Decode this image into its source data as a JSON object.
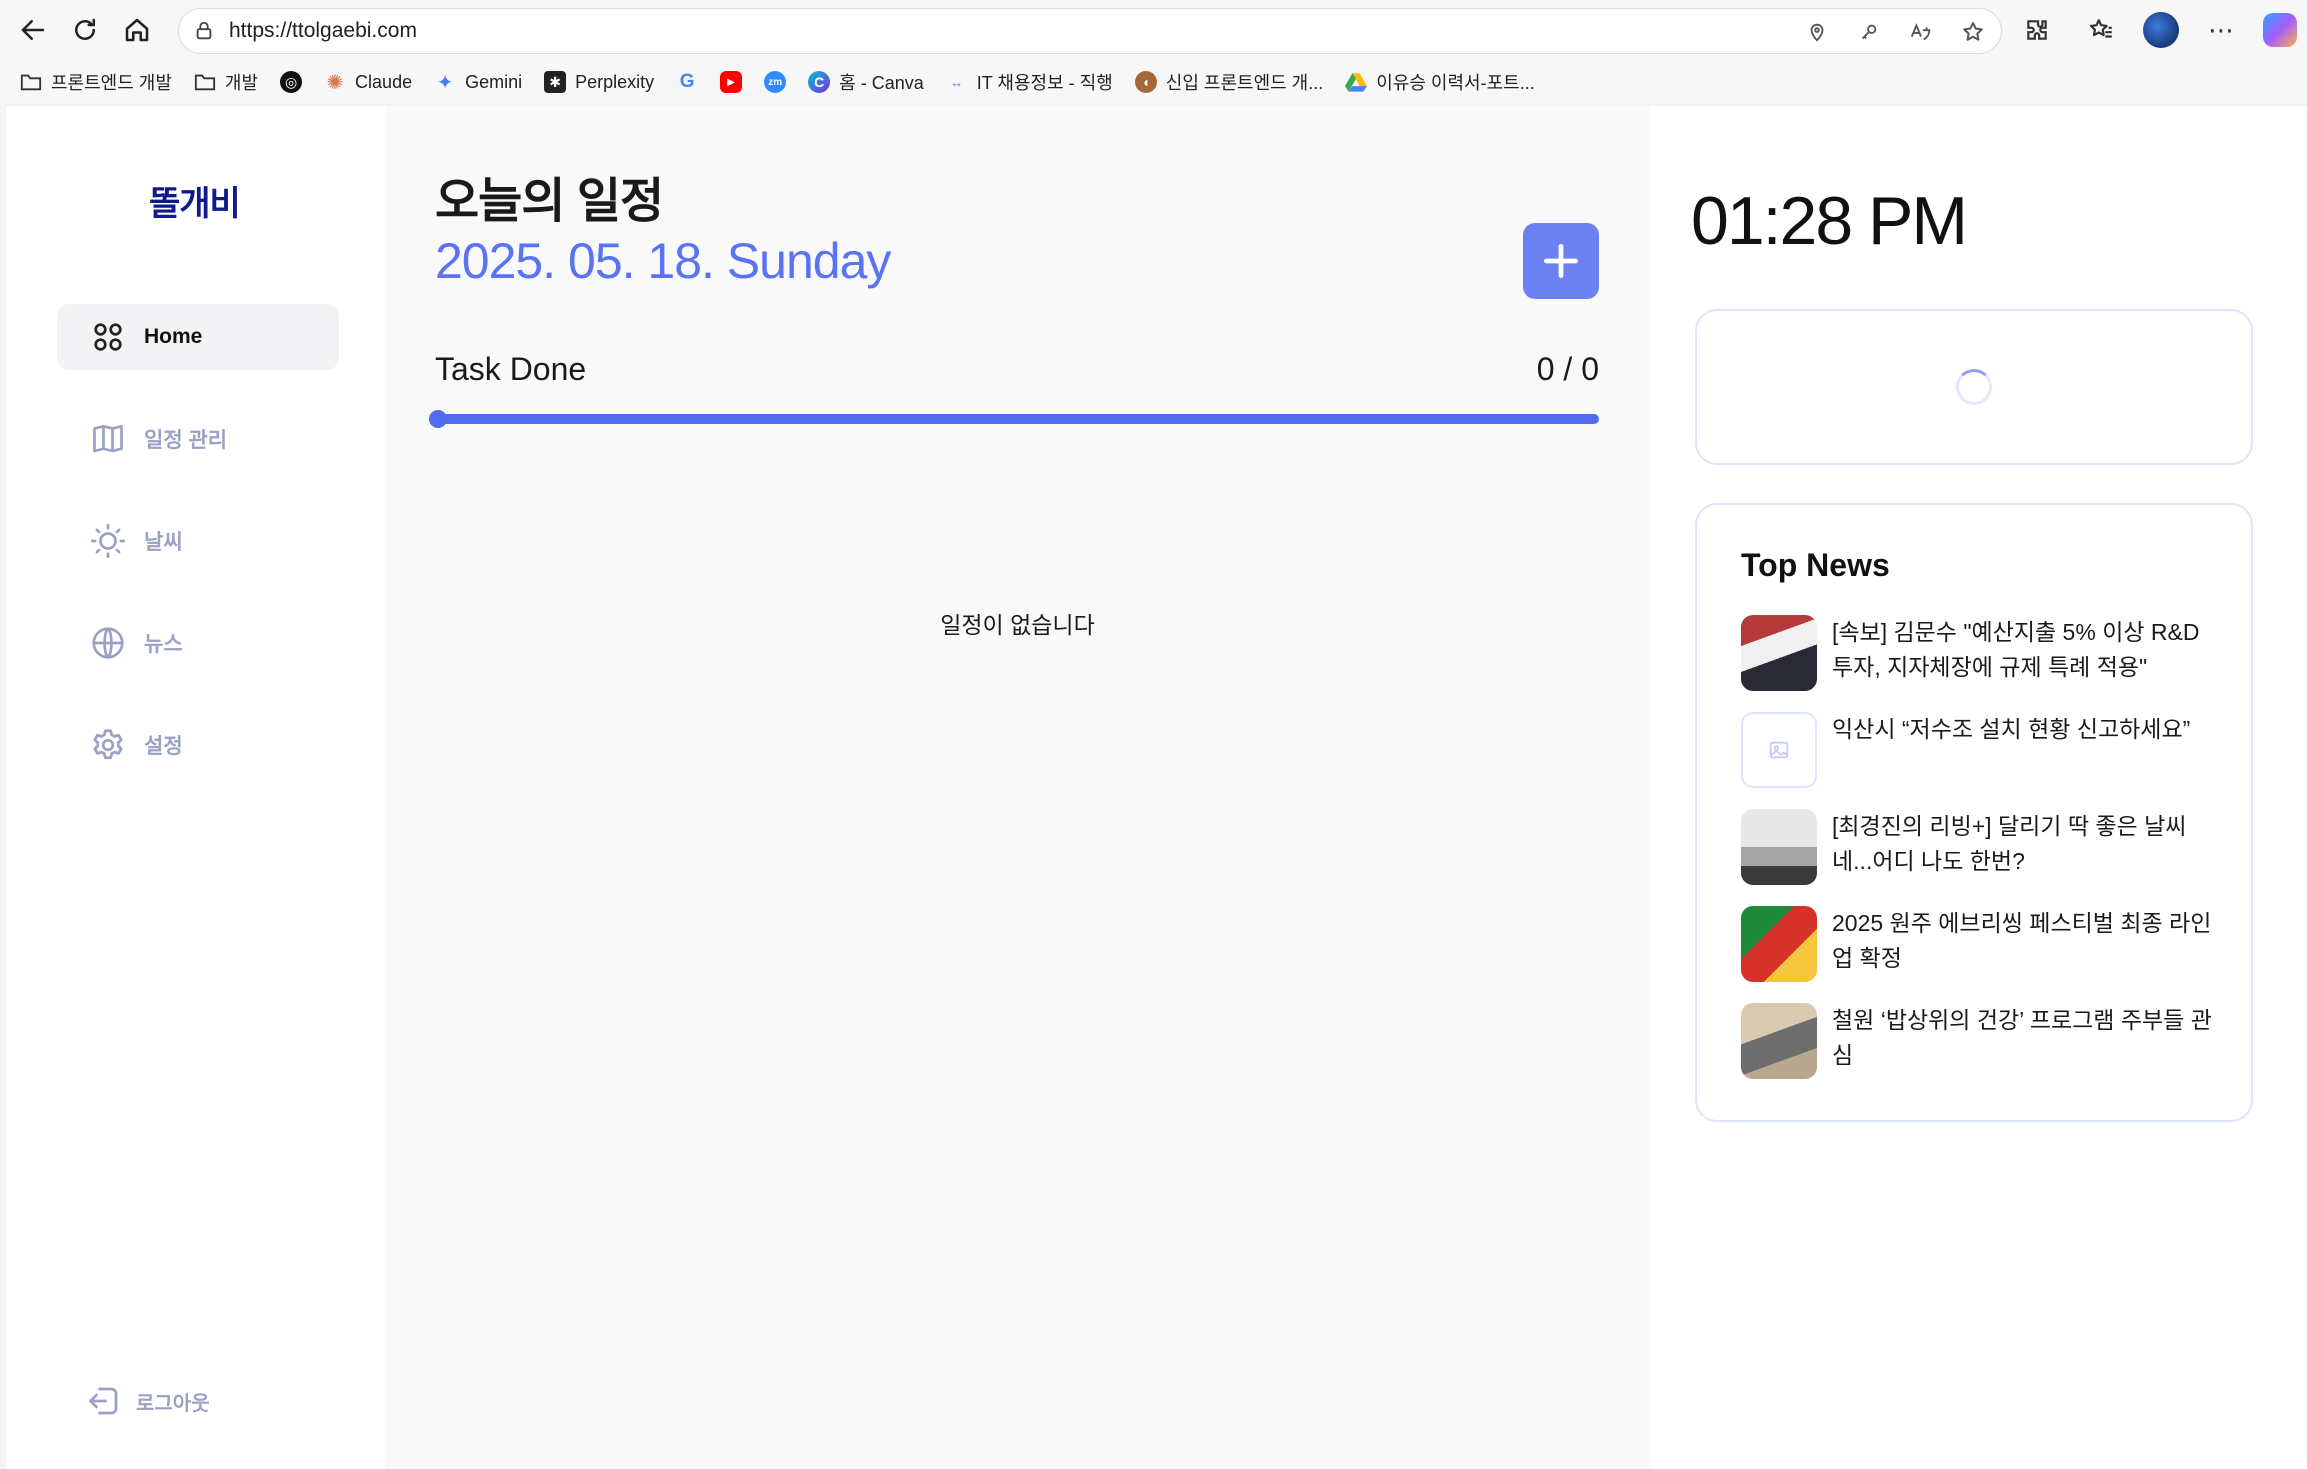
{
  "browser": {
    "url": "https://ttolgaebi.com",
    "icons": {
      "back": "arrow-left-icon",
      "refresh": "refresh-icon",
      "home": "home-icon"
    },
    "bookmarks": [
      {
        "label": "프론트엔드 개발",
        "icon": "folder-icon"
      },
      {
        "label": "개발",
        "icon": "folder-icon"
      },
      {
        "label": "",
        "icon": "openai-icon"
      },
      {
        "label": "Claude",
        "icon": "claude-icon"
      },
      {
        "label": "Gemini",
        "icon": "gemini-icon"
      },
      {
        "label": "Perplexity",
        "icon": "perplexity-icon"
      },
      {
        "label": "",
        "icon": "google-icon"
      },
      {
        "label": "",
        "icon": "youtube-icon"
      },
      {
        "label": "",
        "icon": "zoom-icon"
      },
      {
        "label": "홈 - Canva",
        "icon": "canva-icon"
      },
      {
        "label": "IT 채용정보 - 직행",
        "icon": "jikhaeng-icon"
      },
      {
        "label": "신입 프론트엔드 개...",
        "icon": "squirrel-icon"
      },
      {
        "label": "이유승 이력서-포트...",
        "icon": "google-drive-icon"
      }
    ]
  },
  "sidebar": {
    "logo": "똘개비",
    "items": [
      {
        "label": "Home",
        "icon": "grid-icon",
        "active": true
      },
      {
        "label": "일정 관리",
        "icon": "book-icon",
        "active": false
      },
      {
        "label": "날씨",
        "icon": "sun-icon",
        "active": false
      },
      {
        "label": "뉴스",
        "icon": "globe-icon",
        "active": false
      },
      {
        "label": "설정",
        "icon": "gear-icon",
        "active": false
      }
    ],
    "logout": "로그아웃"
  },
  "main": {
    "title": "오늘의 일정",
    "date": "2025. 05. 18. Sunday",
    "task_label": "Task Done",
    "task_count": "0 / 0",
    "task_progress": 0,
    "empty_text": "일정이 없습니다"
  },
  "right": {
    "clock": "01:28 PM",
    "news_title": "Top News",
    "news": [
      {
        "text": "[속보] 김문수 \"예산지출 5% 이상 R&D 투자, 지자체장에 규제 특례 적용\""
      },
      {
        "text": "익산시 “저수조 설치 현황 신고하세요”"
      },
      {
        "text": "[최경진의 리빙+] 달리기 딱 좋은 날씨네...어디 나도 한번?"
      },
      {
        "text": "2025 원주 에브리씽 페스티벌 최종 라인업 확정"
      },
      {
        "text": "철원 ‘밥상위의 건강’ 프로그램 주부들 관심"
      }
    ]
  },
  "colors": {
    "accent": "#5a73f2",
    "logo": "#101a8c",
    "nav_inactive": "#9aa0c6",
    "card_border": "#dfe4fb"
  }
}
